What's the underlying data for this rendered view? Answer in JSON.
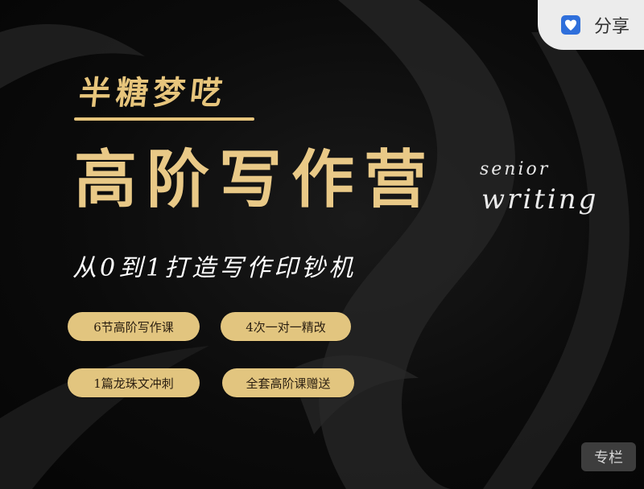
{
  "header": {
    "share_label": "分享",
    "share_icon": "share-heart-icon"
  },
  "banner": {
    "brand": "半糖梦呓",
    "title": "高阶写作营",
    "en_line_1": "senior",
    "en_line_2": "writing",
    "subtitle": "从0到1打造写作印钞机",
    "features": [
      "6节高阶写作课",
      "4次一对一精改",
      "1篇龙珠文冲刺",
      "全套高阶课赠送"
    ]
  },
  "badge": {
    "label": "专栏"
  },
  "colors": {
    "gold": "#e7c57c",
    "pill": "#e2c57f",
    "background": "#0a0a0a",
    "share_bg": "#ececec",
    "share_icon": "#2f6fdb"
  }
}
